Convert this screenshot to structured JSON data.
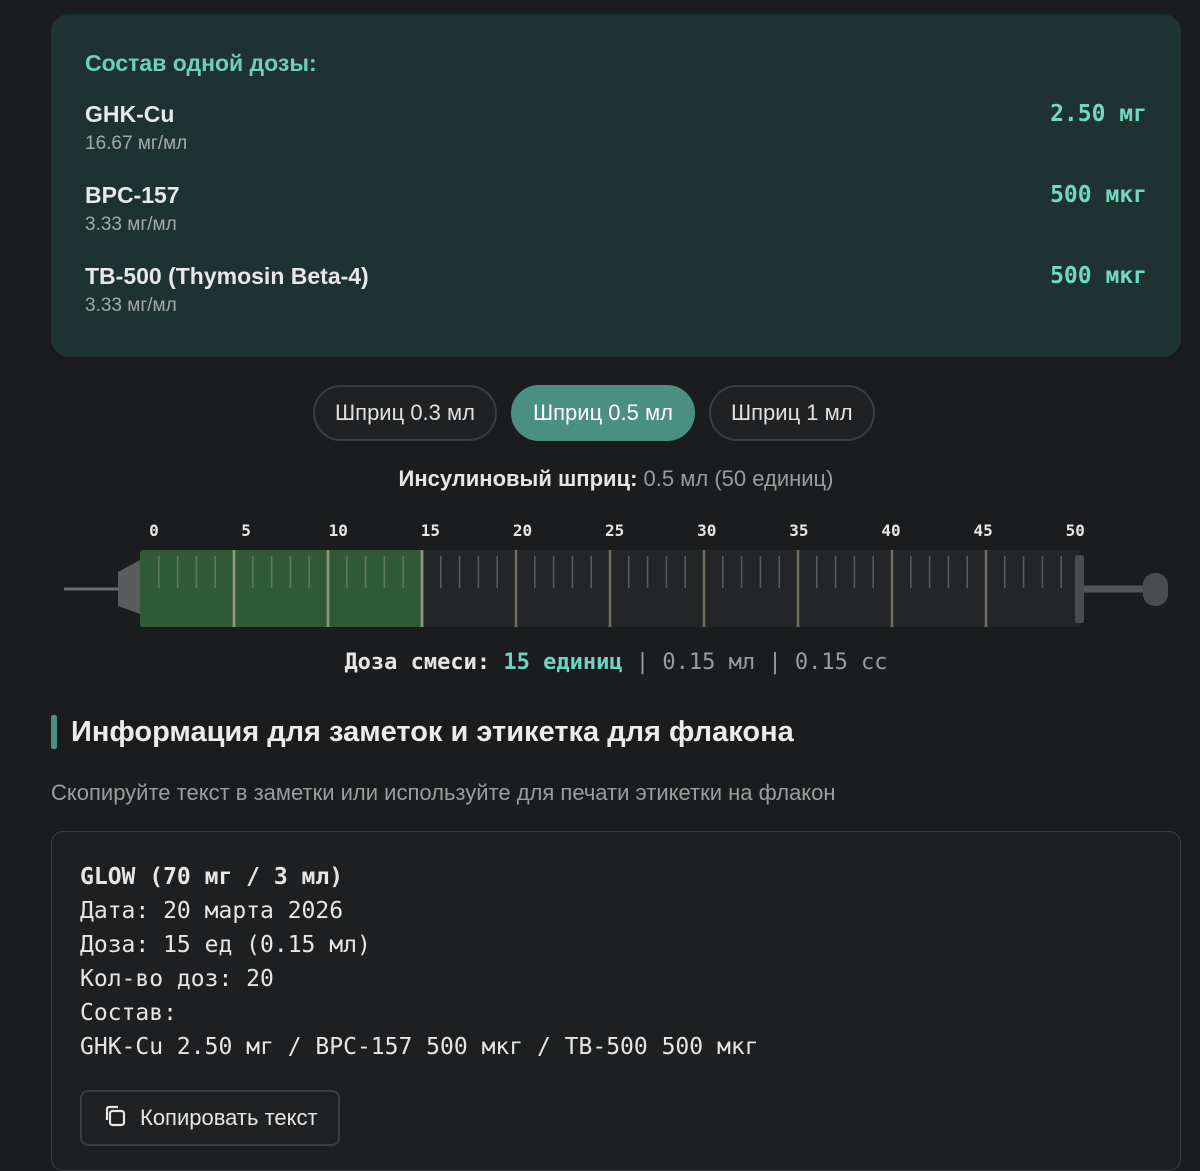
{
  "composition": {
    "title": "Состав одной дозы:",
    "items": [
      {
        "name": "GHK-Cu",
        "concentration": "16.67 мг/мл",
        "amount": "2.50 мг"
      },
      {
        "name": "BPC-157",
        "concentration": "3.33 мг/мл",
        "amount": "500 мкг"
      },
      {
        "name": "TB-500 (Thymosin Beta-4)",
        "concentration": "3.33 мг/мл",
        "amount": "500 мкг"
      }
    ]
  },
  "syringe_tabs": [
    {
      "label": "Шприц 0.3 мл",
      "active": false
    },
    {
      "label": "Шприц 0.5 мл",
      "active": true
    },
    {
      "label": "Шприц 1 мл",
      "active": false
    }
  ],
  "syringe": {
    "caption_label": "Инсулиновый шприц:",
    "caption_value": "0.5 мл (50 единиц)",
    "max_units": 50,
    "filled_units": 15,
    "scale_labels": [
      "0",
      "5",
      "10",
      "15",
      "20",
      "25",
      "30",
      "35",
      "40",
      "45",
      "50"
    ],
    "fill_color": "#2f5a35"
  },
  "dose": {
    "label": "Доза смеси:",
    "units": "15 единиц",
    "sep1": "|",
    "ml": "0.15 мл",
    "sep2": "|",
    "cc": "0.15 cc"
  },
  "notes": {
    "title": "Информация для заметок и этикетка для флакона",
    "subtitle": "Скопируйте текст в заметки или используйте для печати этикетки на флакон",
    "lines": [
      "GLOW (70 мг / 3 мл)",
      "Дата: 20 марта 2026",
      "Доза: 15 ед (0.15 мл)",
      "Кол-во доз: 20",
      "Состав:",
      "GHK-Cu 2.50 мг / BPC-157 500 мкг / TB-500 500 мкг"
    ],
    "copy_button": "Копировать текст",
    "copy_icon": "copy-icon"
  },
  "colors": {
    "accent": "#4a8f82",
    "accent_text": "#6fd3c0",
    "card_bg": "#1e3331",
    "page_bg": "#1b1c1d"
  }
}
